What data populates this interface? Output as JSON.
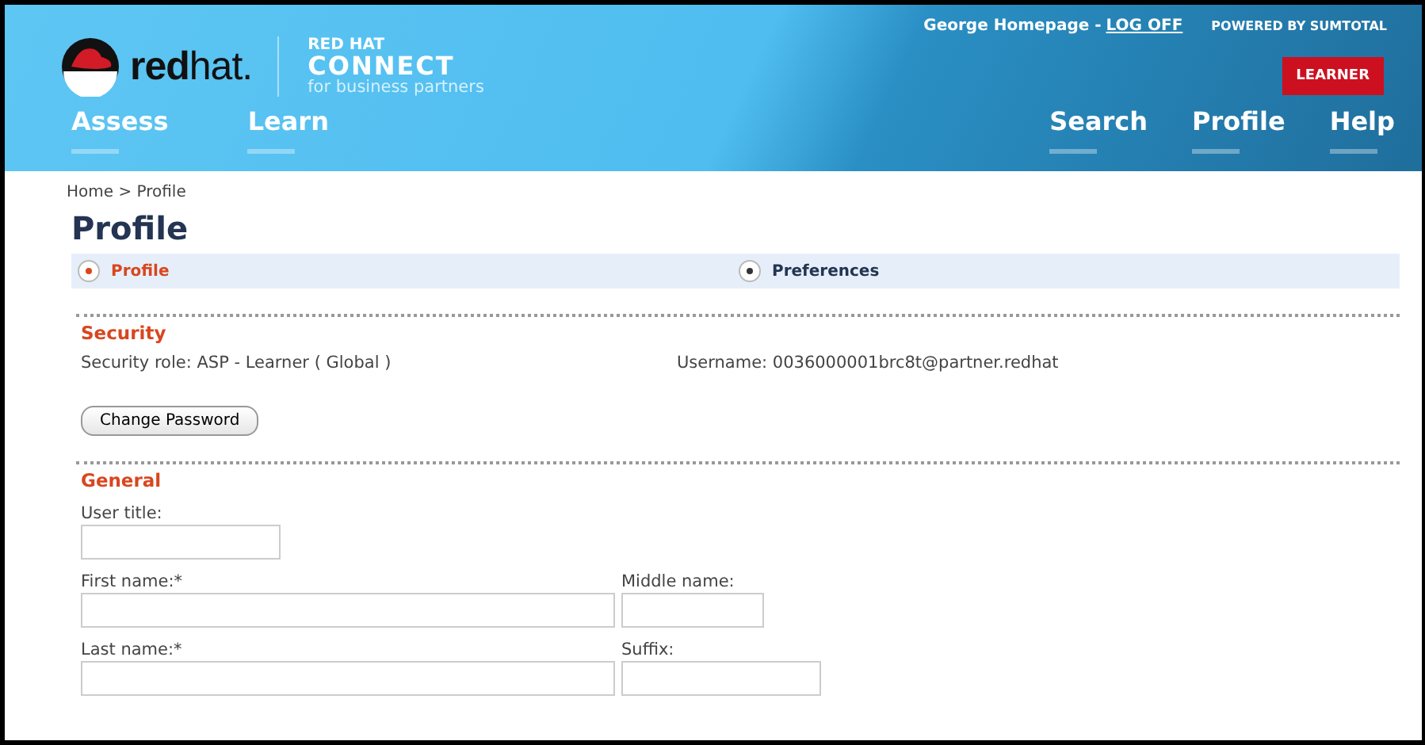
{
  "header": {
    "brand": "**red**hat.",
    "product_top": "RED HAT",
    "product": "CONNECT",
    "product_sub": "for business partners",
    "user": "George Homepage -",
    "logoff": "LOG OFF",
    "powered": "POWERED BY SUMTOTAL",
    "role_button": "LEARNER",
    "nav_left": [
      "Assess",
      "Learn"
    ],
    "nav_right": [
      "Search",
      "Profile",
      "Help"
    ]
  },
  "breadcrumb": "Home > Profile",
  "title": "Profile",
  "steps": [
    {
      "label": "Profile",
      "selected": true
    },
    {
      "label": "Preferences",
      "selected": false
    }
  ],
  "security": {
    "heading": "Security",
    "role": "Security role: ASP - Learner ( Global )",
    "username": "Username: 0036000001brc8t@partner.redhat",
    "button": "Change Password"
  },
  "general": {
    "heading": "General",
    "rows": [
      [
        {
          "label": "User title:"
        }
      ],
      [
        {
          "label": "First name:*"
        },
        {
          "label": "Middle name:"
        }
      ],
      [
        {
          "label": "Last name:*"
        },
        {
          "label": "Suffix:"
        }
      ]
    ]
  }
}
